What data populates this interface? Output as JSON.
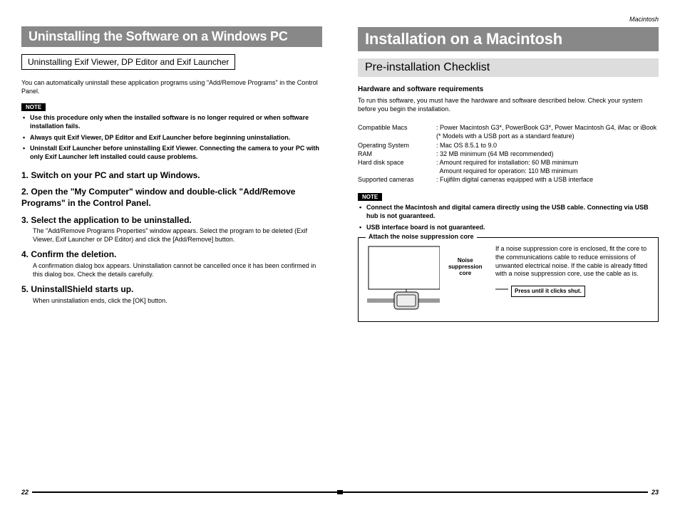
{
  "header": {
    "right_label": "Macintosh"
  },
  "left": {
    "title": "Uninstalling the Software on a Windows PC",
    "section_heading": "Uninstalling Exif Viewer, DP Editor and Exif Launcher",
    "intro": "You can automatically uninstall these application programs using \"Add/Remove Programs\" in the Control Panel.",
    "note_label": "NOTE",
    "notes": [
      "Use this procedure only when the installed software is no longer required or when software installation fails.",
      "Always quit Exif Viewer, DP Editor and Exif Launcher before beginning uninstallation.",
      "Uninstall Exif Launcher before uninstalling Exif Viewer. Connecting the camera to your PC with only Exif Launcher left installed could cause problems."
    ],
    "steps": [
      {
        "num": "1.",
        "head": "Switch on your PC and start up Windows.",
        "body": ""
      },
      {
        "num": "2.",
        "head": "Open the \"My Computer\" window and double-click \"Add/Remove Programs\" in the Control Panel.",
        "body": ""
      },
      {
        "num": "3.",
        "head": "Select the application to be uninstalled.",
        "body": "The \"Add/Remove Programs Properties\" window appears. Select the program to be deleted (Exif Viewer, Exif Launcher or DP Editor) and click the [Add/Remove] button."
      },
      {
        "num": "4.",
        "head": "Confirm the deletion.",
        "body": "A confirmation dialog box appears. Uninstallation cannot be cancelled once it has been confirmed in this dialog box. Check the details carefully."
      },
      {
        "num": "5.",
        "head": "UninstallShield starts up.",
        "body": "When uninstallation ends, click the [OK] button."
      }
    ]
  },
  "right": {
    "title": "Installation on a Macintosh",
    "subtitle": "Pre-installation Checklist",
    "hw_heading": "Hardware and software requirements",
    "hw_intro": "To run this software, you must have the hardware and software described below. Check your system before you begin the installation.",
    "reqs": [
      {
        "label": "Compatible Macs",
        "value": ": Power Macintosh G3*, PowerBook G3*, Power Macintosh G4, iMac or iBook",
        "value2": "(* Models with a USB port as a standard feature)"
      },
      {
        "label": "Operating System",
        "value": ": Mac OS 8.5.1 to 9.0"
      },
      {
        "label": "RAM",
        "value": ": 32 MB minimum (64 MB recommended)"
      },
      {
        "label": "Hard disk space",
        "value": ": Amount required for installation: 60 MB minimum",
        "value2": "  Amount required for operation: 110 MB minimum"
      },
      {
        "label": "Supported cameras",
        "value": ": Fujifilm digital cameras equipped with a USB interface"
      }
    ],
    "note_label": "NOTE",
    "notes": [
      "Connect the Macintosh and digital camera directly using the USB cable. Connecting via USB hub is not guaranteed.",
      "USB interface board is not guaranteed."
    ],
    "fieldset_title": "Attach the noise suppression core",
    "callout1a": "Noise",
    "callout1b": "suppression core",
    "diag_text": "If a noise suppression core is enclosed, fit the core to the communications cable to reduce emissions of unwanted electrical noise. If the cable is already fitted with a noise suppression core, use the cable as is.",
    "press_label": "Press until it clicks shut."
  },
  "footer": {
    "left": "22",
    "right": "23"
  }
}
